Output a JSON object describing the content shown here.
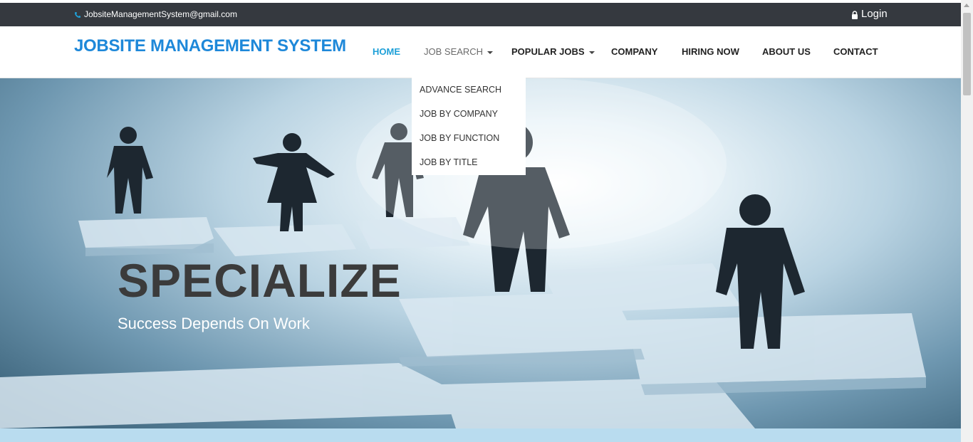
{
  "topbar": {
    "email": "JobsiteManagementSystem@gmail.com",
    "login_label": "Login",
    "phone_icon": "phone-icon",
    "lock_icon": "lock-icon"
  },
  "brand": {
    "title": "JOBSITE MANAGEMENT SYSTEM",
    "color": "#1e88d9"
  },
  "nav": {
    "items": [
      {
        "label": "HOME"
      },
      {
        "label": "JOB SEARCH"
      },
      {
        "label": "POPULAR JOBS"
      },
      {
        "label": "COMPANY"
      },
      {
        "label": "HIRING NOW"
      },
      {
        "label": "ABOUT US"
      },
      {
        "label": "CONTACT"
      }
    ],
    "active_color": "#1fa0d8"
  },
  "job_search_menu": {
    "items": [
      {
        "label": "ADVANCE SEARCH"
      },
      {
        "label": "JOB BY COMPANY"
      },
      {
        "label": "JOB BY FUNCTION"
      },
      {
        "label": "JOB BY TITLE"
      }
    ]
  },
  "hero": {
    "title": "SPECIALIZE",
    "subtitle": "Success Depends On Work"
  }
}
